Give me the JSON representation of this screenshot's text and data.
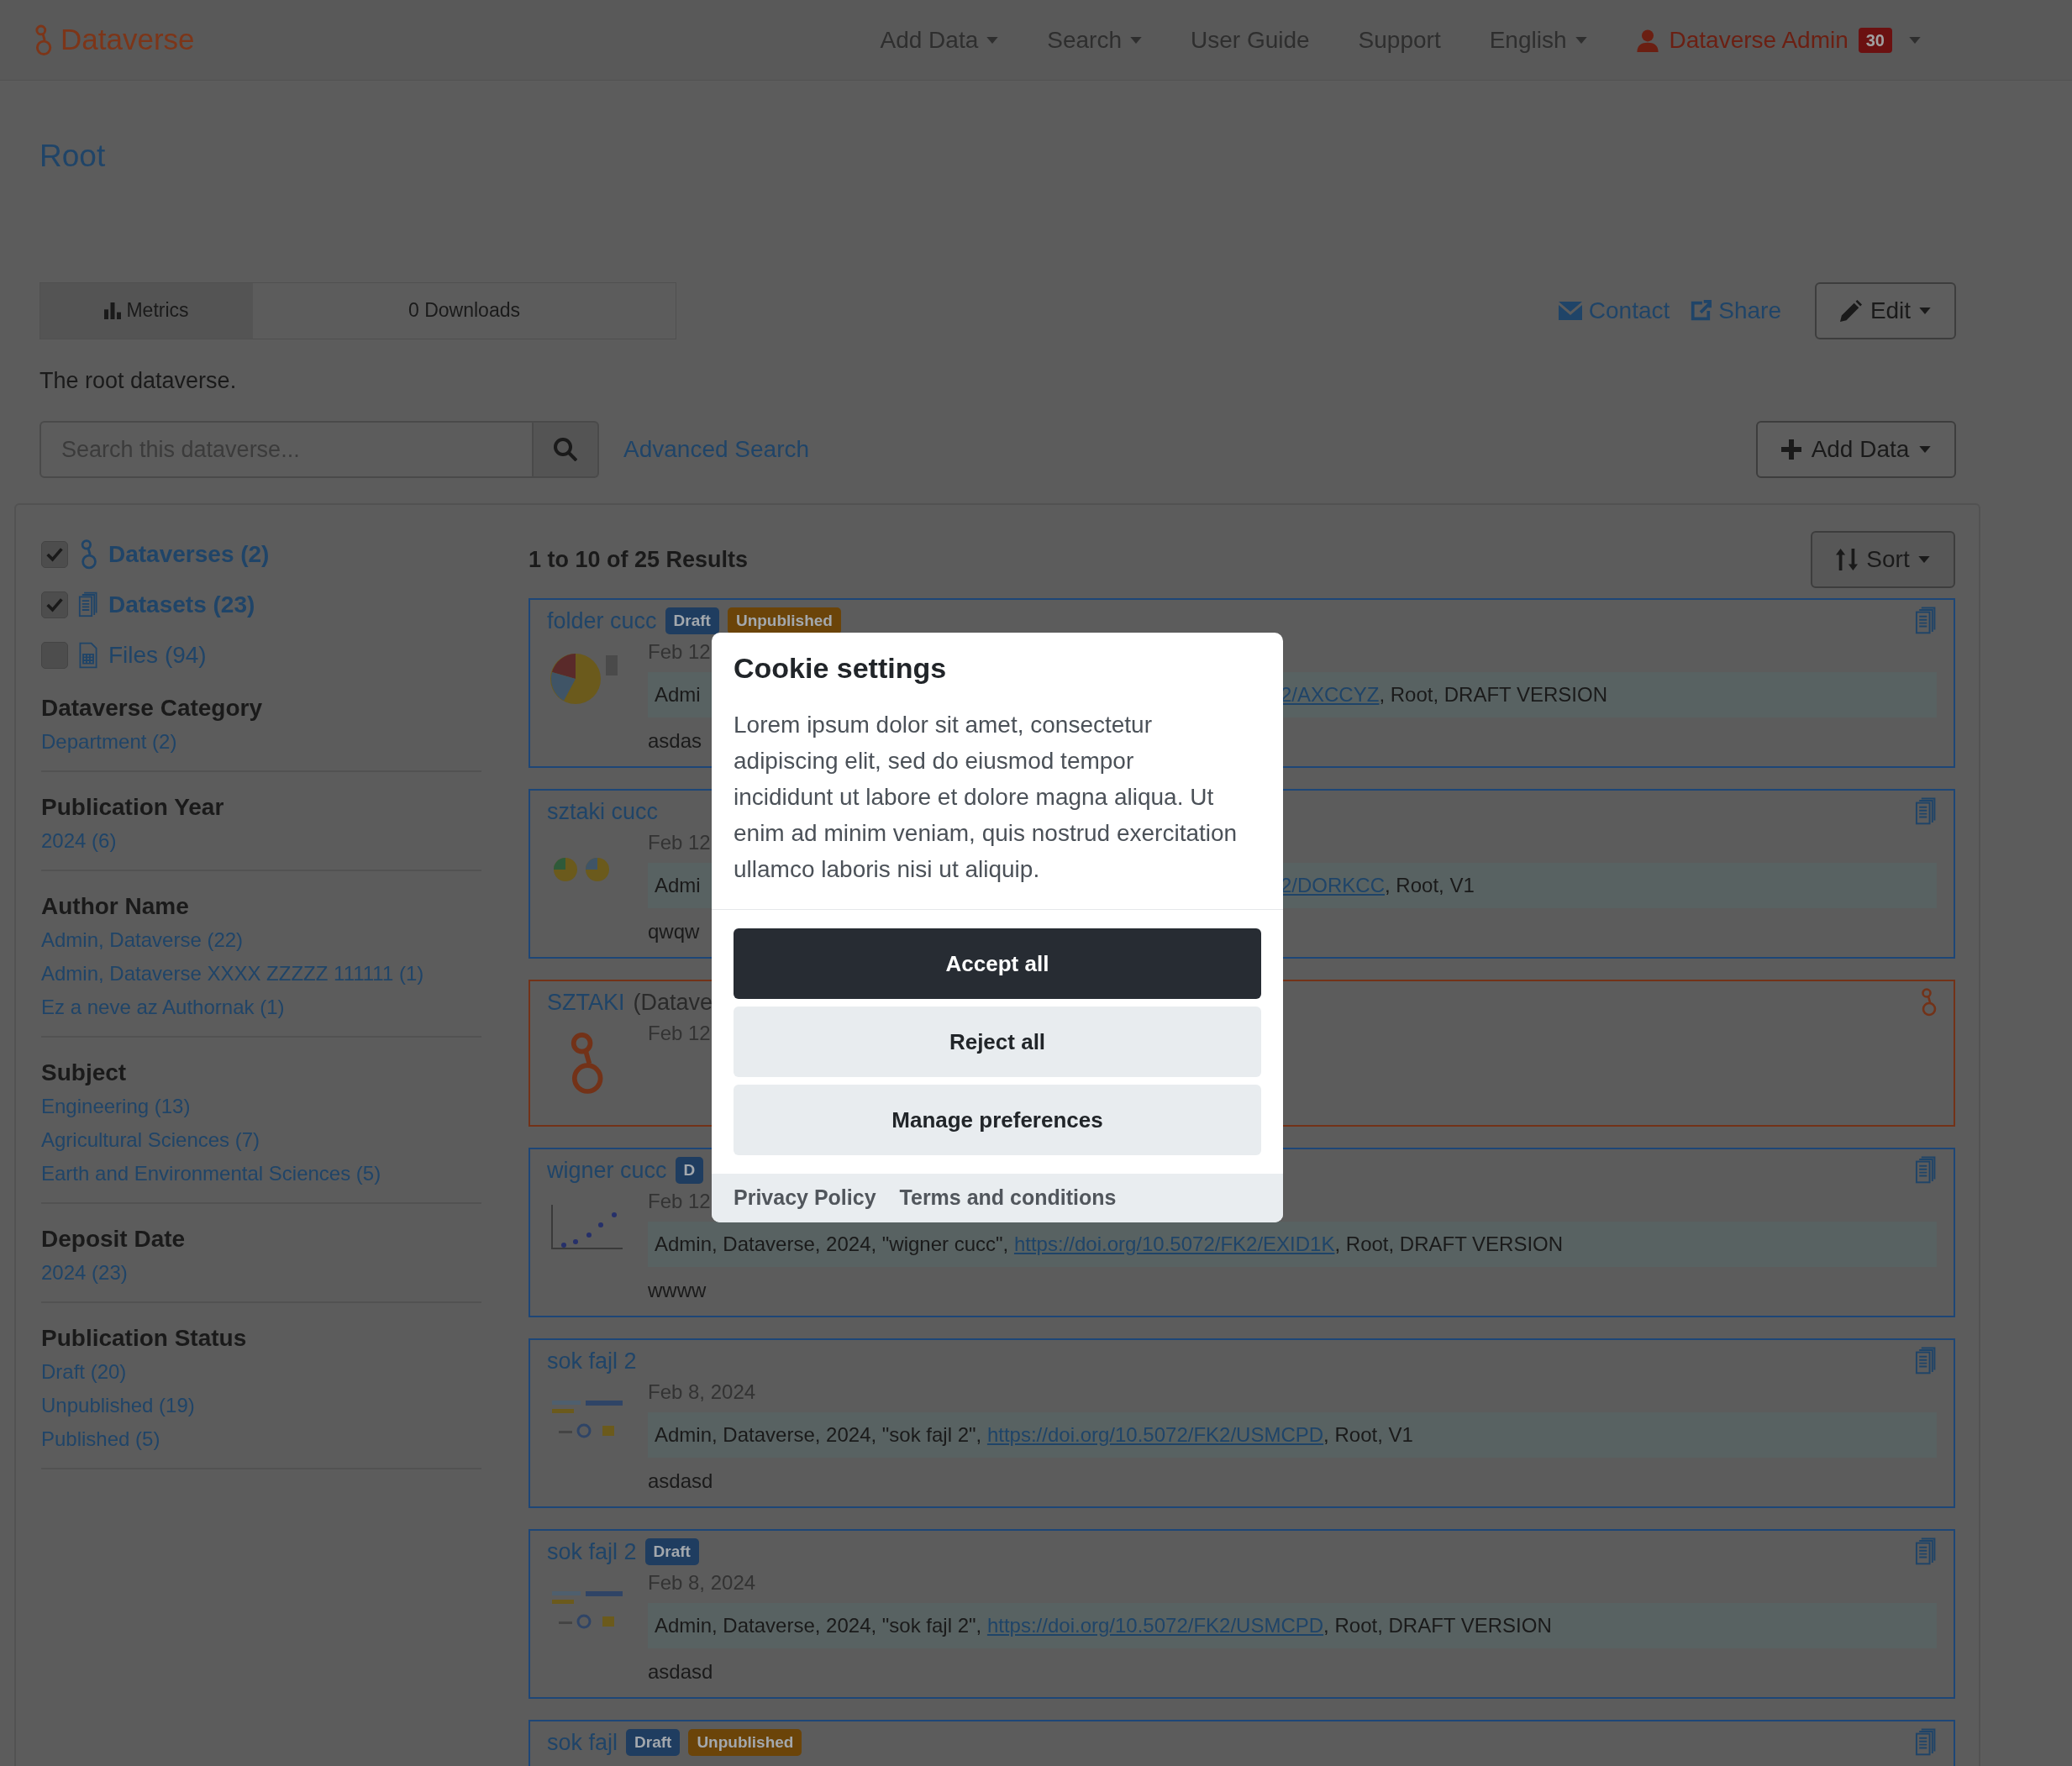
{
  "navbar": {
    "brand": "Dataverse",
    "items": [
      {
        "label": "Add Data",
        "dropdown": true
      },
      {
        "label": "Search",
        "dropdown": true
      },
      {
        "label": "User Guide",
        "dropdown": false
      },
      {
        "label": "Support",
        "dropdown": false
      },
      {
        "label": "English",
        "dropdown": true
      }
    ],
    "user": {
      "name": "Dataverse Admin",
      "badge": "30"
    }
  },
  "page": {
    "title": "Root",
    "metrics": {
      "label": "Metrics",
      "downloads": "0 Downloads"
    },
    "contact": "Contact",
    "share": "Share",
    "edit": "Edit",
    "description": "The root dataverse.",
    "search": {
      "placeholder": "Search this dataverse...",
      "advanced": "Advanced Search"
    },
    "add_data": "Add Data"
  },
  "facets": {
    "types": [
      {
        "kind": "dataverse",
        "label": "Dataverses (2)",
        "checked": true
      },
      {
        "kind": "dataset",
        "label": "Datasets (23)",
        "checked": true
      },
      {
        "kind": "file",
        "label": "Files (94)",
        "checked": false
      }
    ],
    "groups": [
      {
        "title": "Dataverse Category",
        "items": [
          "Department (2)"
        ]
      },
      {
        "title": "Publication Year",
        "items": [
          "2024 (6)"
        ]
      },
      {
        "title": "Author Name",
        "items": [
          "Admin, Dataverse (22)",
          "Admin, Dataverse XXXX ZZZZZ 111111 (1)",
          "Ez a neve az Authornak (1)"
        ]
      },
      {
        "title": "Subject",
        "items": [
          "Engineering (13)",
          "Agricultural Sciences (7)",
          "Earth and Environmental Sciences (5)"
        ]
      },
      {
        "title": "Deposit Date",
        "items": [
          "2024 (23)"
        ]
      },
      {
        "title": "Publication Status",
        "items": [
          "Draft (20)",
          "Unpublished (19)",
          "Published (5)"
        ]
      }
    ]
  },
  "results": {
    "summary": "1 to 10 of 25 Results",
    "sort": "Sort",
    "cards": [
      {
        "kind": "dataset",
        "title": "folder cucc",
        "badges": [
          {
            "kind": "draft",
            "label": "Draft"
          },
          {
            "kind": "unpublished",
            "label": "Unpublished"
          }
        ],
        "thumbnail": true,
        "date": "Feb 12",
        "citation": [
          {
            "text": "Admi"
          }
        ],
        "citation_tail": [
          {
            "text": "2/AXCCYZ",
            "link": true
          },
          {
            "text": ", Root, DRAFT VERSION"
          }
        ],
        "description": "asdas"
      },
      {
        "kind": "dataset",
        "title": "sztaki cucc",
        "thumbnail": true,
        "date": "Feb 12",
        "citation": [
          {
            "text": "Admi"
          }
        ],
        "citation_tail": [
          {
            "text": "2/DORKCC",
            "link": true
          },
          {
            "text": ", Root, V1"
          }
        ],
        "description": "qwqw"
      },
      {
        "kind": "dataverse",
        "title": "SZTAKI",
        "affiliation": "(Datave",
        "date": "Feb 12"
      },
      {
        "kind": "dataset",
        "title": "wigner cucc",
        "badges": [
          {
            "kind": "draft",
            "label": "D"
          }
        ],
        "thumbnail": true,
        "date": "Feb 12",
        "citation": [
          {
            "text": "Admin, Dataverse, 2024, \"wigner cucc\", "
          },
          {
            "text": "https://doi.org/10.5072/FK2/EXID1K",
            "link": true
          },
          {
            "text": ", Root, DRAFT VERSION"
          }
        ],
        "description": "wwww"
      },
      {
        "kind": "dataset",
        "title": "sok fajl 2",
        "thumbnail": true,
        "date": "Feb 8, 2024",
        "citation": [
          {
            "text": "Admin, Dataverse, 2024, \"sok fajl 2\", "
          },
          {
            "text": "https://doi.org/10.5072/FK2/USMCPD",
            "link": true
          },
          {
            "text": ", Root, V1"
          }
        ],
        "description": "asdasd"
      },
      {
        "kind": "dataset",
        "title": "sok fajl 2",
        "badges": [
          {
            "kind": "draft",
            "label": "Draft"
          }
        ],
        "thumbnail": true,
        "date": "Feb 8, 2024",
        "citation": [
          {
            "text": "Admin, Dataverse, 2024, \"sok fajl 2\", "
          },
          {
            "text": "https://doi.org/10.5072/FK2/USMCPD",
            "link": true
          },
          {
            "text": ", Root, DRAFT VERSION"
          }
        ],
        "description": "asdasd"
      },
      {
        "kind": "dataset",
        "title": "sok fajl",
        "badges": [
          {
            "kind": "draft",
            "label": "Draft"
          },
          {
            "kind": "unpublished",
            "label": "Unpublished"
          }
        ]
      }
    ]
  },
  "cookie_dialog": {
    "title": "Cookie settings",
    "body": "Lorem ipsum dolor sit amet, consectetur adipiscing elit, sed do eiusmod tempor incididunt ut labore et dolore magna aliqua. Ut enim ad minim veniam, quis nostrud exercitation ullamco laboris nisi ut aliquip.",
    "buttons": [
      {
        "kind": "primary",
        "label": "Accept all"
      },
      {
        "kind": "secondary",
        "label": "Reject all"
      },
      {
        "kind": "secondary",
        "label": "Manage preferences"
      }
    ],
    "links": [
      "Privacy Policy",
      "Terms and conditions"
    ]
  }
}
